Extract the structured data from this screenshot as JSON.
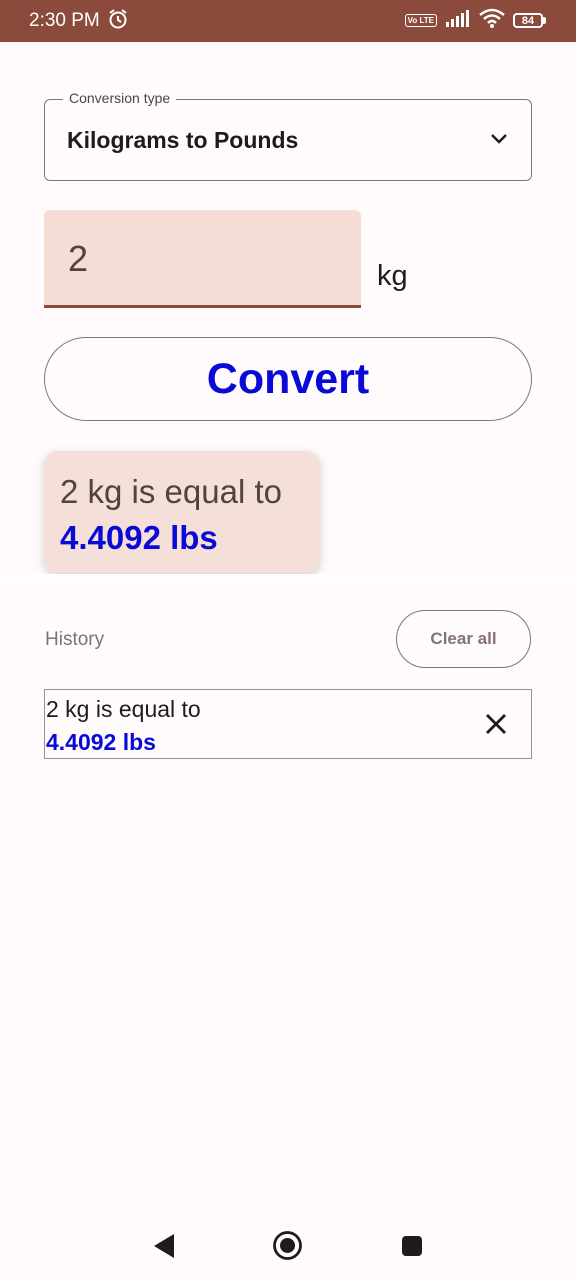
{
  "status_bar": {
    "time": "2:30 PM",
    "volte": "Vo LTE",
    "battery": "84",
    "icons": [
      "alarm-icon",
      "volte-icon",
      "signal-icon",
      "wifi-icon",
      "battery-icon"
    ]
  },
  "dropdown": {
    "label": "Conversion type",
    "value": "Kilograms to Pounds",
    "icon": "chevron-down-icon"
  },
  "input": {
    "value": "2",
    "unit": "kg"
  },
  "convert_button": {
    "label": "Convert"
  },
  "result": {
    "line1": "2 kg is equal to",
    "line2": "4.4092 lbs"
  },
  "history": {
    "label": "History",
    "clear_all_label": "Clear all",
    "items": [
      {
        "line1": "2 kg is equal to",
        "line2": "4.4092 lbs"
      }
    ]
  },
  "nav_bar": {
    "icons": [
      "back-icon",
      "home-icon",
      "recents-icon"
    ]
  },
  "colors": {
    "accent": "#8b4a3c",
    "result_blue": "#0a0ad6",
    "field_background": "#f5ddd6",
    "background": "#fffbfd"
  }
}
